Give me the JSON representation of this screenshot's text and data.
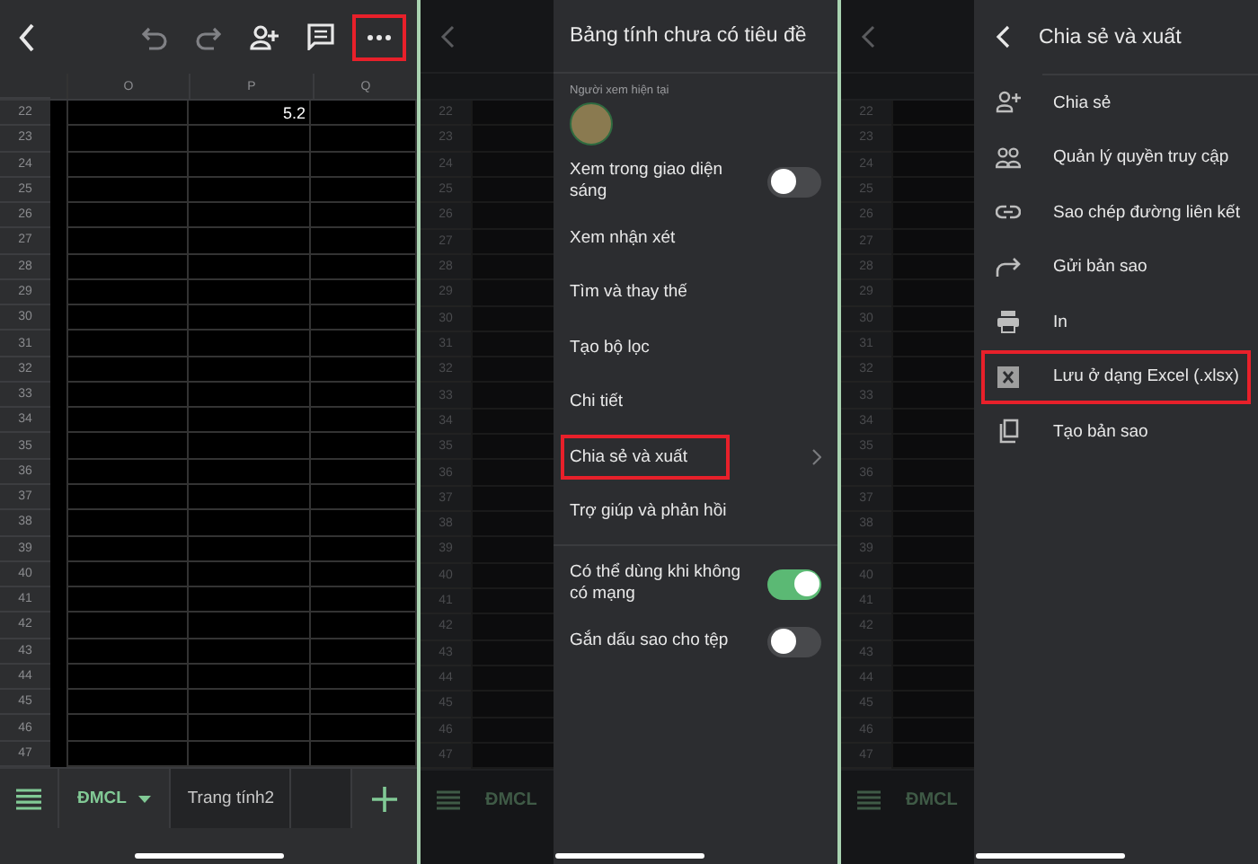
{
  "sheet_screen": {
    "toolbar_buttons": [
      {
        "disabled": false,
        "highlighted": false
      },
      {
        "disabled": true,
        "highlighted": false
      },
      {
        "disabled": true,
        "highlighted": false
      },
      {
        "disabled": false,
        "highlighted": false
      },
      {
        "disabled": false,
        "highlighted": false
      },
      {
        "disabled": false,
        "highlighted": true
      }
    ],
    "columns": [
      "O",
      "P",
      "Q"
    ],
    "rows": [
      {
        "number": "22",
        "cells": {
          "P": "5.2"
        }
      },
      {
        "number": "23"
      },
      {
        "number": "24"
      },
      {
        "number": "25"
      },
      {
        "number": "26"
      },
      {
        "number": "27"
      },
      {
        "number": "28"
      },
      {
        "number": "29"
      },
      {
        "number": "30"
      },
      {
        "number": "31"
      },
      {
        "number": "32"
      },
      {
        "number": "33"
      },
      {
        "number": "34"
      },
      {
        "number": "35"
      },
      {
        "number": "36"
      },
      {
        "number": "37"
      },
      {
        "number": "38"
      },
      {
        "number": "39"
      },
      {
        "number": "40"
      },
      {
        "number": "41"
      },
      {
        "number": "42"
      },
      {
        "number": "43"
      },
      {
        "number": "44"
      },
      {
        "number": "45"
      },
      {
        "number": "46"
      },
      {
        "number": "47"
      }
    ],
    "sheet_tabs": [
      {
        "label": "ĐMCL",
        "selected": true
      },
      {
        "label": "Trang tính2",
        "selected": false
      }
    ]
  },
  "menu_screen": {
    "background_rows": [
      "22",
      "23",
      "24",
      "25",
      "26",
      "27",
      "28",
      "29",
      "30",
      "31",
      "32",
      "33",
      "34",
      "35",
      "36",
      "37",
      "38",
      "39",
      "40",
      "41",
      "42",
      "43",
      "44",
      "45",
      "46",
      "47"
    ],
    "background_tab": "ĐMCL",
    "title": "Bảng tính chưa có tiêu đề",
    "viewers_label": "Người xem hiện tại",
    "sections": [
      [
        {
          "kind": "toggle",
          "label": "Xem trong giao diện sáng",
          "on": false
        },
        {
          "kind": "link",
          "label": "Xem nhận xét",
          "highlighted": false,
          "submenu": false
        },
        {
          "kind": "link",
          "label": "Tìm và thay thế",
          "highlighted": false,
          "submenu": false
        },
        {
          "kind": "link",
          "label": "Tạo bộ lọc",
          "highlighted": false,
          "submenu": false
        },
        {
          "kind": "link",
          "label": "Chi tiết",
          "highlighted": false,
          "submenu": false
        },
        {
          "kind": "link",
          "label": "Chia sẻ và xuất",
          "highlighted": true,
          "submenu": true
        },
        {
          "kind": "link",
          "label": "Trợ giúp và phản hồi",
          "highlighted": false,
          "submenu": false
        }
      ],
      [
        {
          "kind": "toggle",
          "label": "Có thể dùng khi không có mạng",
          "on": true
        },
        {
          "kind": "toggle",
          "label": "Gắn dấu sao cho tệp",
          "on": false
        }
      ]
    ]
  },
  "share_screen": {
    "background_rows": [
      "22",
      "23",
      "24",
      "25",
      "26",
      "27",
      "28",
      "29",
      "30",
      "31",
      "32",
      "33",
      "34",
      "35",
      "36",
      "37",
      "38",
      "39",
      "40",
      "41",
      "42",
      "43",
      "44",
      "45",
      "46",
      "47"
    ],
    "background_tab": "ĐMCL",
    "title": "Chia sẻ và xuất",
    "items": [
      {
        "label": "Chia sẻ",
        "highlighted": false
      },
      {
        "label": "Quản lý quyền truy cập",
        "highlighted": false
      },
      {
        "label": "Sao chép đường liên kết",
        "highlighted": false
      },
      {
        "label": "Gửi bản sao",
        "highlighted": false
      },
      {
        "label": "In",
        "highlighted": false
      },
      {
        "label": "Lưu ở dạng Excel (.xlsx)",
        "highlighted": true
      },
      {
        "label": "Tạo bản sao",
        "highlighted": false
      }
    ]
  }
}
